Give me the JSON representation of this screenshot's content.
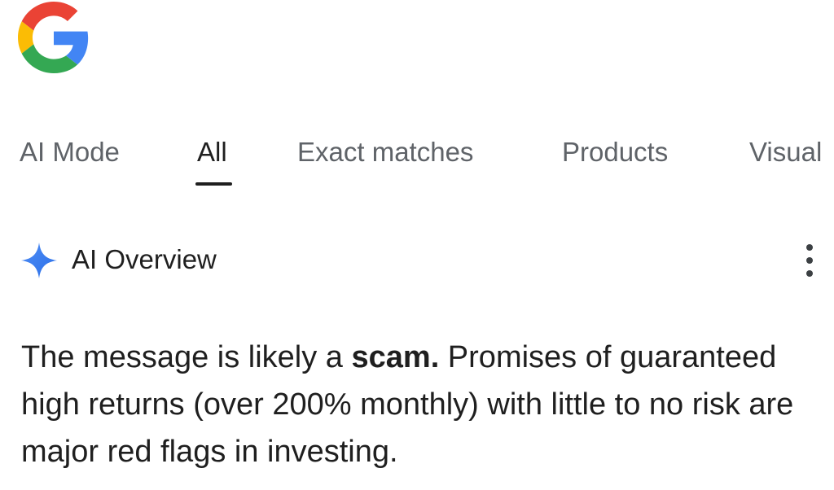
{
  "logo": {
    "icon": "google-g-logo",
    "colors": [
      "#4285F4",
      "#EA4335",
      "#FBBC05",
      "#34A853"
    ]
  },
  "tabs": [
    {
      "label": "AI Mode",
      "active": false
    },
    {
      "label": "All",
      "active": true
    },
    {
      "label": "Exact matches",
      "active": false
    },
    {
      "label": "Products",
      "active": false
    },
    {
      "label": "Visual",
      "active": false
    }
  ],
  "ai_overview": {
    "icon": "gemini-sparkle-icon",
    "title": "AI Overview",
    "menu_icon": "more-vert-icon",
    "body_prefix": "The message is likely a ",
    "body_bold": "scam.",
    "body_suffix": " Promises of guaranteed high returns (over 200% monthly) with little to no risk are major red flags in investing."
  },
  "colors": {
    "text_primary": "#1f1f1f",
    "text_secondary": "#5f6368",
    "accent": "#4285F4"
  }
}
